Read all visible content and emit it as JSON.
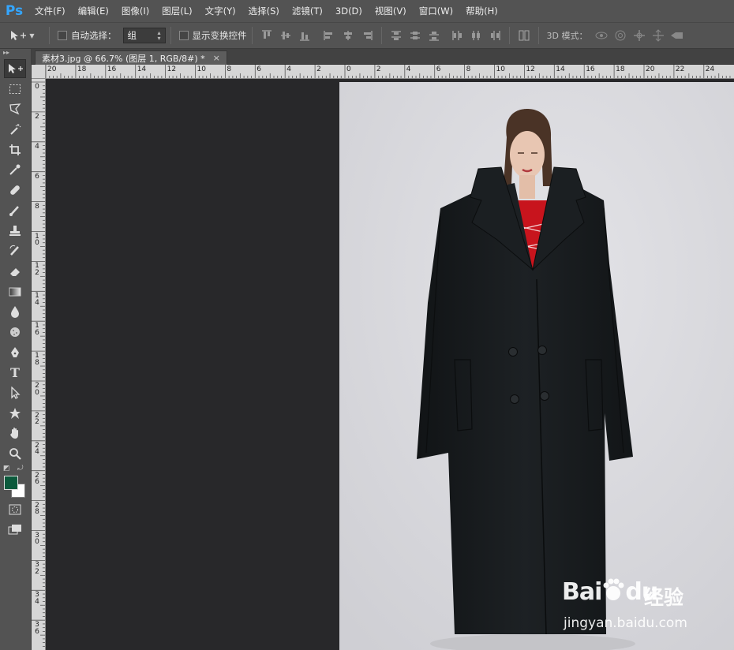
{
  "app": {
    "logo": "Ps"
  },
  "menu": [
    "文件(F)",
    "编辑(E)",
    "图像(I)",
    "图层(L)",
    "文字(Y)",
    "选择(S)",
    "滤镜(T)",
    "3D(D)",
    "视图(V)",
    "窗口(W)",
    "帮助(H)"
  ],
  "options": {
    "auto_select_label": "自动选择：",
    "auto_select_checked": false,
    "auto_select_target": "组",
    "show_transform_label": "显示变换控件",
    "show_transform_checked": false,
    "mode_3d_label": "3D 模式："
  },
  "document": {
    "tab_title": "素材3.jpg @ 66.7% (图层 1, RGB/8#) *",
    "close_glyph": "×"
  },
  "rulers": {
    "top_labels": [
      "20",
      "18",
      "16",
      "14",
      "12",
      "10",
      "8",
      "6",
      "4",
      "2",
      "0",
      "2",
      "4",
      "6",
      "8",
      "10",
      "12",
      "14",
      "16",
      "18",
      "20",
      "22",
      "24"
    ],
    "left_labels": [
      "0",
      "2",
      "4",
      "6",
      "8",
      "10",
      "12",
      "14",
      "16",
      "18",
      "20",
      "22",
      "24",
      "26",
      "28",
      "30",
      "32",
      "34",
      "36"
    ]
  },
  "colors": {
    "foreground": "#0c5a3c",
    "background": "#ffffff"
  },
  "watermark": {
    "brand": "Bai",
    "brand2": "du",
    "cn": "经验",
    "url": "jingyan.baidu.com"
  }
}
